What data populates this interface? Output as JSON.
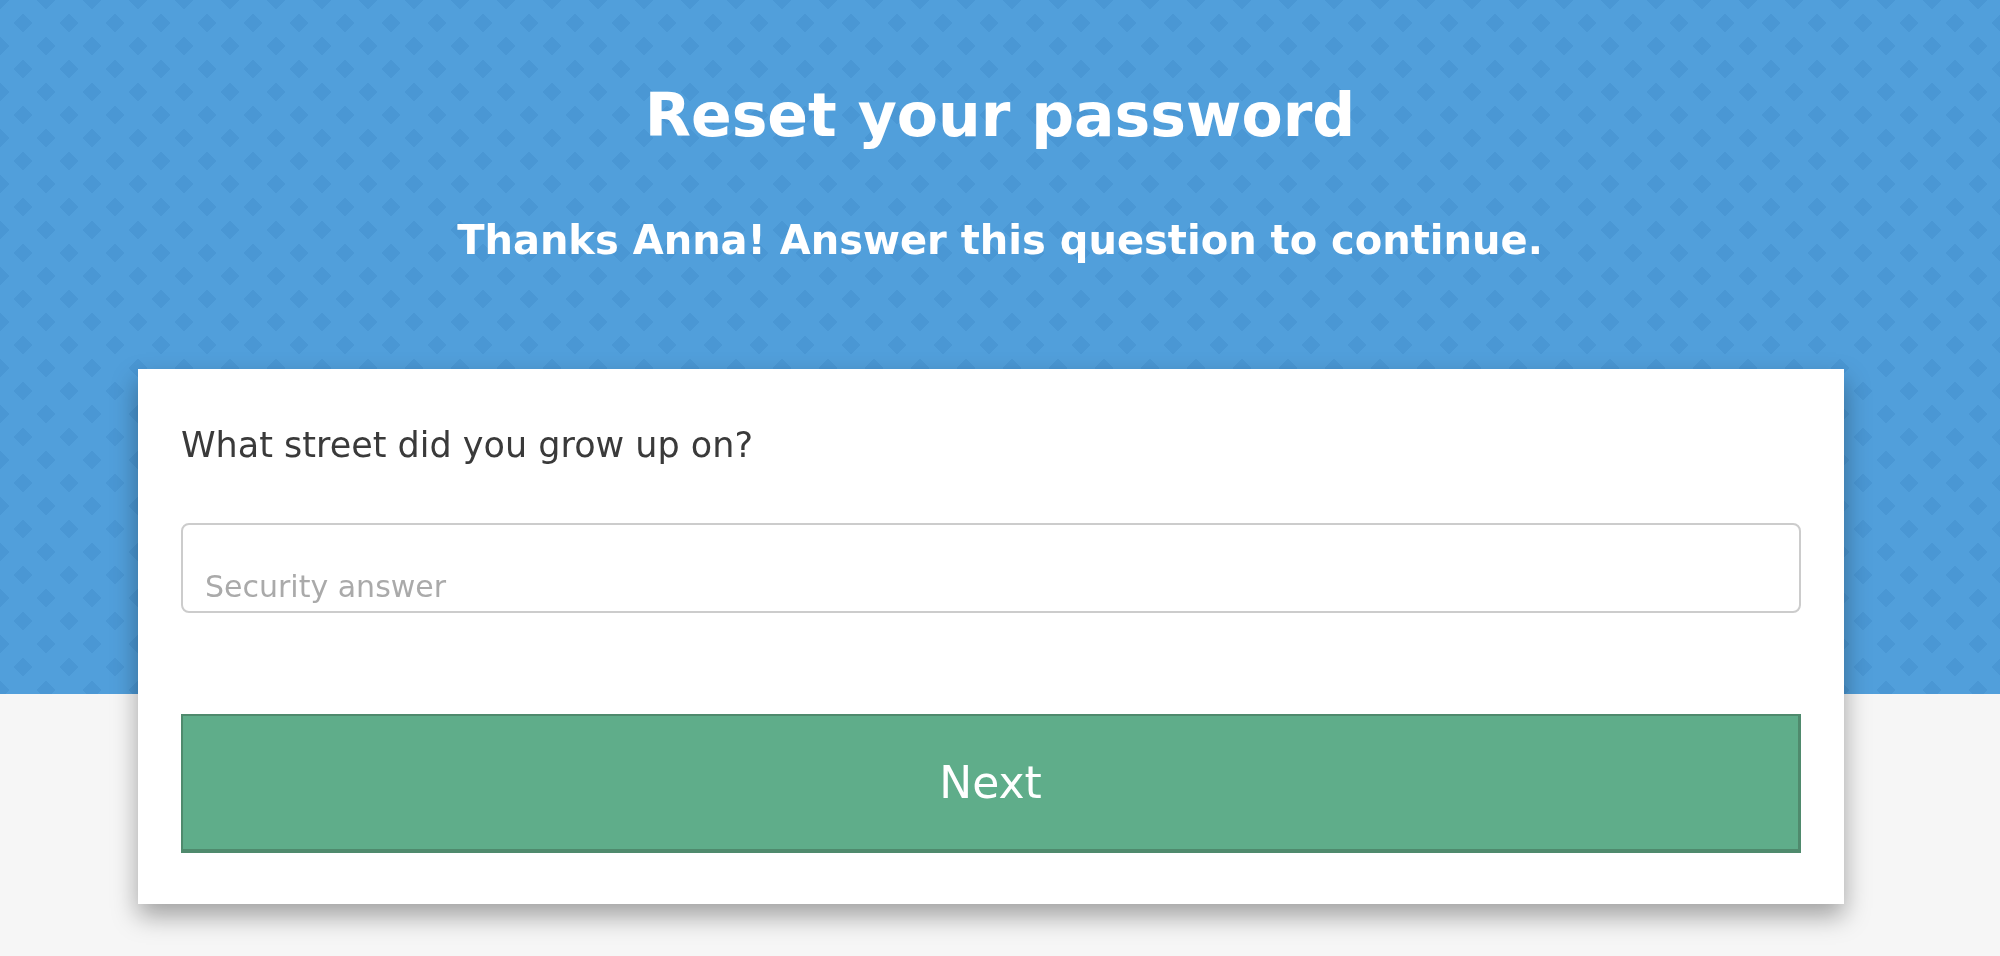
{
  "header": {
    "title": "Reset your password",
    "subtitle": "Thanks Anna! Answer this question to continue."
  },
  "form": {
    "question": "What street did you grow up on?",
    "answer_field": {
      "placeholder": "Security answer"
    },
    "submit_button": {
      "label": "Next"
    }
  }
}
